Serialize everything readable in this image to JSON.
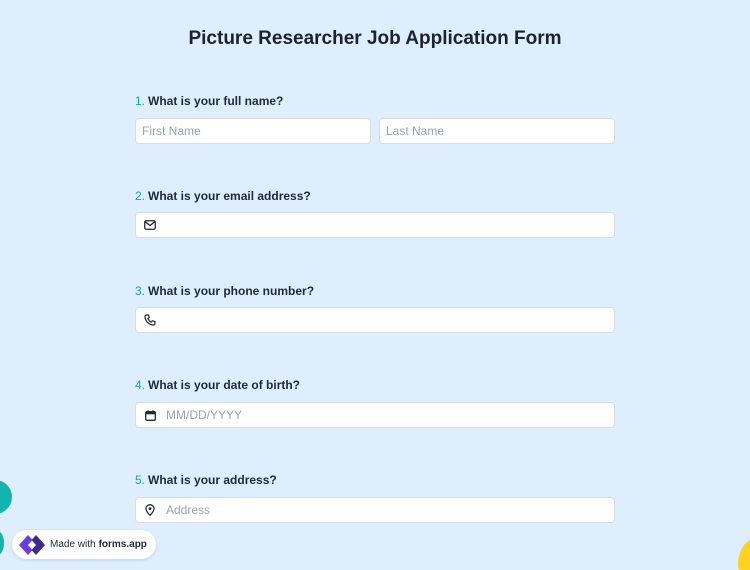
{
  "form": {
    "title": "Picture Researcher Job Application Form"
  },
  "questions": [
    {
      "number": "1.",
      "label": "What is your full name?",
      "fields": [
        {
          "placeholder": "First Name",
          "value": ""
        },
        {
          "placeholder": "Last Name",
          "value": ""
        }
      ]
    },
    {
      "number": "2.",
      "label": "What is your email address?",
      "icon": "envelope-icon",
      "field": {
        "placeholder": "",
        "value": ""
      }
    },
    {
      "number": "3.",
      "label": "What is your phone number?",
      "icon": "phone-icon",
      "field": {
        "placeholder": "",
        "value": ""
      }
    },
    {
      "number": "4.",
      "label": "What is your date of birth?",
      "icon": "calendar-icon",
      "field": {
        "placeholder": "MM/DD/YYYY",
        "value": ""
      }
    },
    {
      "number": "5.",
      "label": "What is your address?",
      "icon": "location-pin-icon",
      "field": {
        "placeholder": "Address",
        "value": ""
      }
    }
  ],
  "badge": {
    "prefix": "Made with",
    "brand": "forms.app",
    "icon": "forms-app-logo"
  },
  "colors": {
    "background": "#deeefc",
    "accent": "#1ca3a0",
    "brand_purple": "#6c3ce0",
    "decor_teal": "#13b3b0",
    "decor_yellow": "#ffd21e"
  }
}
